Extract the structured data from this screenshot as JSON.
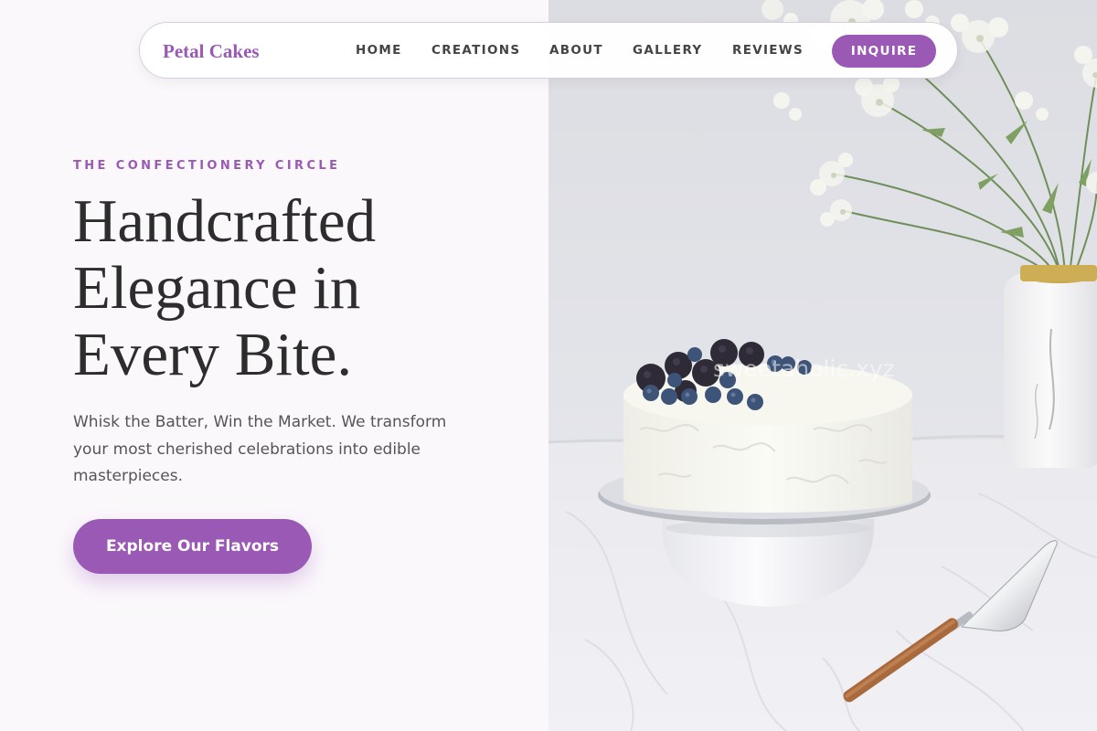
{
  "nav": {
    "logo": "Petal Cakes",
    "links": [
      "HOME",
      "CREATIONS",
      "ABOUT",
      "GALLERY",
      "REVIEWS"
    ],
    "cta": "INQUIRE"
  },
  "hero": {
    "eyebrow": "THE CONFECTIONERY CIRCLE",
    "headline_lines": [
      "Handcrafted",
      "Elegance in",
      "Every Bite."
    ],
    "subtext": "Whisk the Batter, Win the Market. We transform your most cherished celebrations into edible masterpieces.",
    "button": "Explore Our Flavors"
  },
  "photo": {
    "watermark": "sweetaholic.xyz",
    "subject": "white frosted cake topped with blackberries and blueberries on a cake stand, vase of baby's breath, cake server"
  },
  "colors": {
    "accent": "#9b59b6",
    "heading": "#2d2d2d",
    "body_text": "#555555",
    "page_bg": "#fbf8fc"
  }
}
